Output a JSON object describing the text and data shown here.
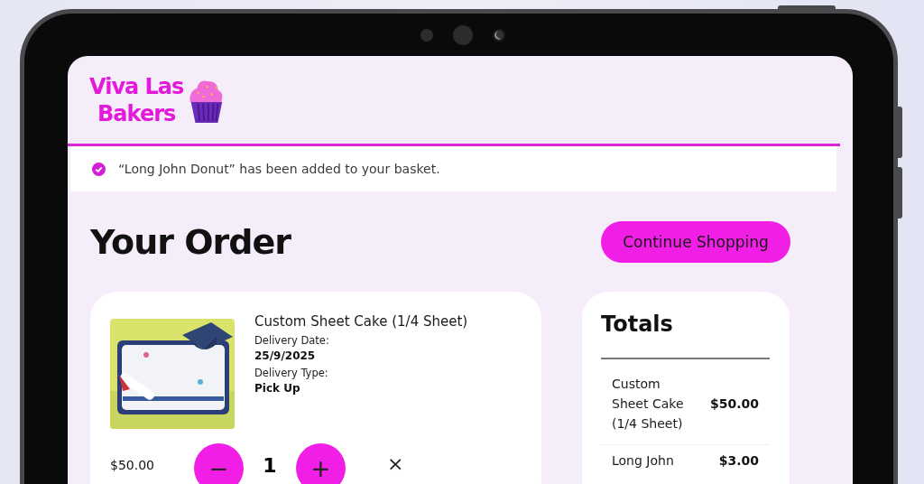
{
  "logo": {
    "lines": [
      "Viva Las",
      "Bakers"
    ]
  },
  "notice": {
    "message": "“Long John Donut” has been added to your basket."
  },
  "heading": "Your Order",
  "continue_button": "Continue Shopping",
  "cart_items": [
    {
      "name": "Custom Sheet Cake (1/4 Sheet)",
      "details": [
        {
          "label": "Delivery Date:",
          "value": "25/9/2025"
        },
        {
          "label": "Delivery Type:",
          "value": "Pick Up"
        }
      ],
      "price": "$50.00",
      "minus": "−",
      "quantity": "1",
      "plus": "+",
      "remove": "×"
    }
  ],
  "totals": {
    "title": "Totals",
    "rows": [
      {
        "item": "Custom Sheet Cake (1/4 Sheet)",
        "amount": "$50.00"
      },
      {
        "item": "Long John",
        "amount": "$3.00"
      }
    ]
  }
}
